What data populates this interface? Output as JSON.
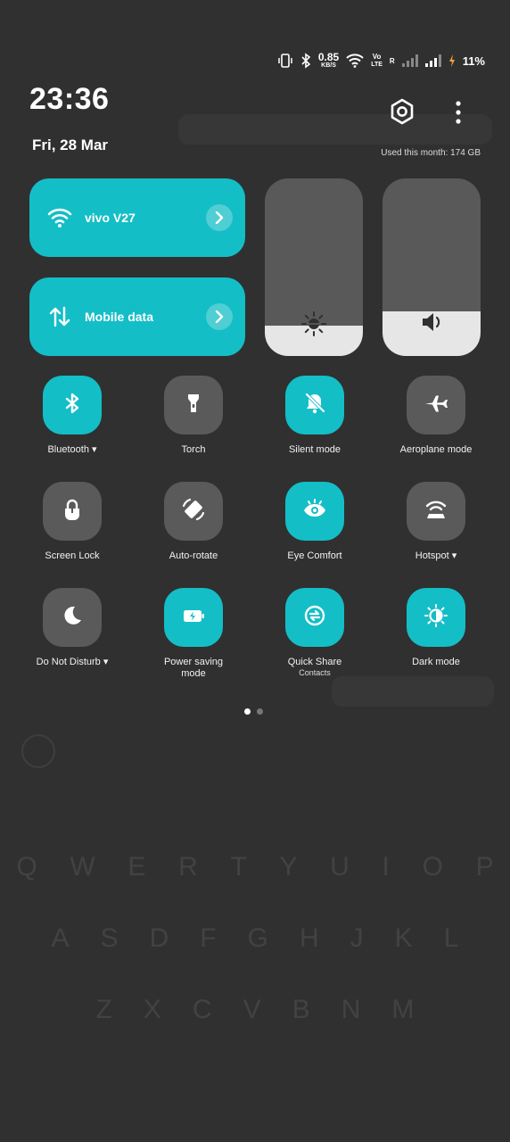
{
  "status_bar": {
    "speed": "0.85",
    "speed_unit": "KB/S",
    "volte_top": "Vo",
    "volte_bottom": "LTE",
    "roaming": "R",
    "battery": "11%"
  },
  "header": {
    "time": "23:36",
    "date": "Fri, 28 Mar",
    "data_usage": "Used this month: 174 GB"
  },
  "wide_tiles": [
    {
      "label": "vivo V27",
      "icon": "wifi-icon",
      "active": true
    },
    {
      "label": "Mobile data",
      "icon": "mobile-data-icon",
      "active": true
    }
  ],
  "sliders": {
    "brightness_level": 0.17,
    "volume_level": 0.25
  },
  "toggles": [
    {
      "label": "Bluetooth ▾",
      "icon": "bluetooth-icon",
      "on": true
    },
    {
      "label": "Torch",
      "icon": "torch-icon",
      "on": false
    },
    {
      "label": "Silent mode",
      "icon": "bell-off-icon",
      "on": true
    },
    {
      "label": "Aeroplane mode",
      "icon": "airplane-icon",
      "on": false
    },
    {
      "label": "Screen Lock",
      "icon": "lock-icon",
      "on": false
    },
    {
      "label": "Auto-rotate",
      "icon": "rotate-icon",
      "on": false
    },
    {
      "label": "Eye Comfort",
      "icon": "eye-icon",
      "on": true
    },
    {
      "label": "Hotspot ▾",
      "icon": "hotspot-icon",
      "on": false
    },
    {
      "label": "Do Not Disturb ▾",
      "icon": "moon-icon",
      "on": false
    },
    {
      "label": "Power saving mode",
      "icon": "battery-saver-icon",
      "on": true
    },
    {
      "label": "Quick Share",
      "sublabel": "Contacts",
      "icon": "quick-share-icon",
      "on": true
    },
    {
      "label": "Dark mode",
      "icon": "dark-mode-icon",
      "on": true
    }
  ],
  "pager": {
    "pages": 2,
    "current": 1
  },
  "colors": {
    "accent": "#14bec6",
    "panel": "#303030",
    "off_tile": "#5a5a5a",
    "slider_track": "#595959",
    "slider_fill": "#e6e6e6"
  }
}
